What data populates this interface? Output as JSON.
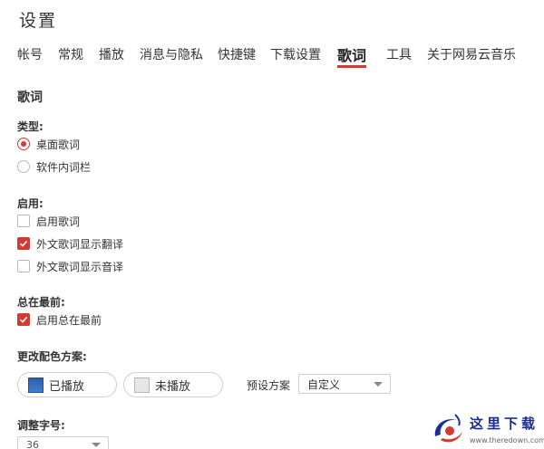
{
  "window": {
    "title": "设置"
  },
  "tabs": [
    {
      "label": "帐号",
      "active": false
    },
    {
      "label": "常规",
      "active": false
    },
    {
      "label": "播放",
      "active": false
    },
    {
      "label": "消息与隐私",
      "active": false
    },
    {
      "label": "快捷键",
      "active": false
    },
    {
      "label": "下载设置",
      "active": false
    },
    {
      "label": "歌词",
      "active": true
    },
    {
      "label": "工具",
      "active": false
    },
    {
      "label": "关于网易云音乐",
      "active": false
    }
  ],
  "section": {
    "title": "歌词"
  },
  "type_group": {
    "label": "类型:",
    "options": [
      {
        "label": "桌面歌词",
        "selected": true
      },
      {
        "label": "软件内词栏",
        "selected": false
      }
    ]
  },
  "enable_group": {
    "label": "启用:",
    "options": [
      {
        "label": "启用歌词",
        "checked": false
      },
      {
        "label": "外文歌词显示翻译",
        "checked": true
      },
      {
        "label": "外文歌词显示音译",
        "checked": false
      }
    ]
  },
  "ontop_group": {
    "label": "总在最前:",
    "options": [
      {
        "label": "启用总在最前",
        "checked": true
      }
    ]
  },
  "color_group": {
    "label": "更改配色方案:",
    "played_label": "已播放",
    "unplayed_label": "未播放",
    "preset_label": "预设方案",
    "preset_value": "自定义"
  },
  "font_group": {
    "label": "调整字号:",
    "size_value": "36"
  },
  "watermark": {
    "text": "这里下载",
    "url": "www.theredown.com"
  },
  "colors": {
    "accent": "#d33a31",
    "text": "#333333"
  }
}
